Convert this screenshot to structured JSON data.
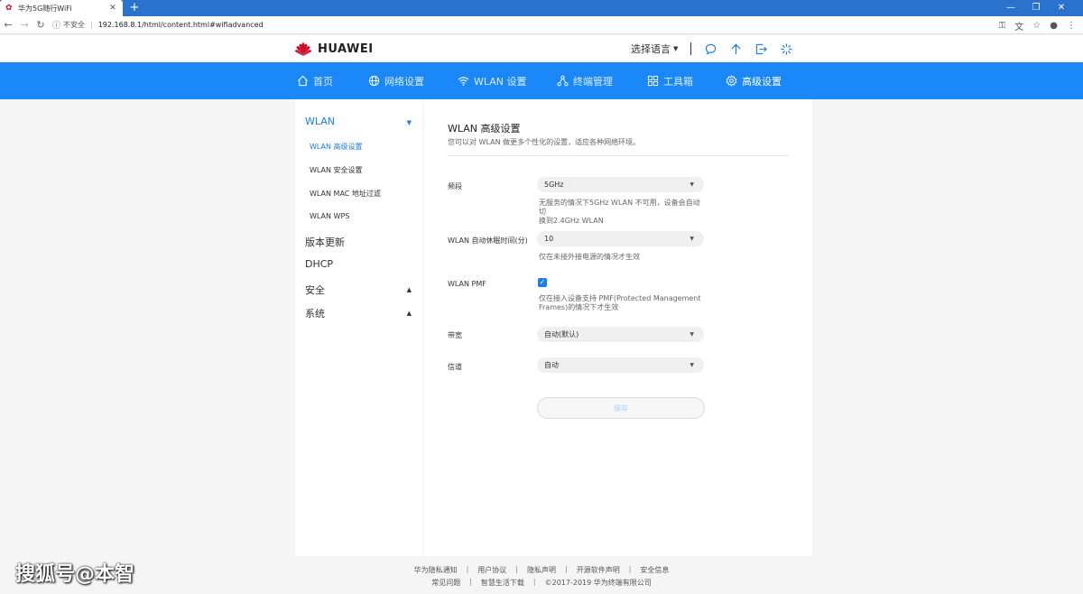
{
  "browser": {
    "tab_title": "华为5G随行WiFi",
    "new_tab": "+",
    "insecure_label": "不安全",
    "separator": "|",
    "url": "192.168.8.1/html/content.html#wifiadvanced"
  },
  "header": {
    "brand": "HUAWEI",
    "language_label": "选择语言",
    "colors": {
      "accent": "#1a7ee8",
      "nav_bg": "#1a88f8",
      "brand_red": "#cf0a2c"
    }
  },
  "nav": {
    "items": [
      {
        "label": "首页",
        "icon": "home-icon"
      },
      {
        "label": "网络设置",
        "icon": "globe-icon"
      },
      {
        "label": "WLAN 设置",
        "icon": "wifi-icon"
      },
      {
        "label": "终端管理",
        "icon": "devices-icon"
      },
      {
        "label": "工具箱",
        "icon": "toolbox-icon"
      },
      {
        "label": "高级设置",
        "icon": "gear-icon",
        "active": true
      }
    ]
  },
  "sidebar": {
    "groups": [
      {
        "label": "WLAN",
        "expanded": true,
        "active": true
      },
      {
        "label": "版本更新"
      },
      {
        "label": "DHCP"
      },
      {
        "label": "安全",
        "collapsible": true
      },
      {
        "label": "系统",
        "collapsible": true
      }
    ],
    "wlan_items": [
      {
        "label": "WLAN 高级设置",
        "active": true
      },
      {
        "label": "WLAN 安全设置"
      },
      {
        "label": "WLAN MAC 地址过滤"
      },
      {
        "label": "WLAN WPS"
      }
    ]
  },
  "main": {
    "title": "WLAN 高级设置",
    "description": "您可以对 WLAN 做更多个性化的设置，适应各种网络环境。",
    "fields": {
      "band": {
        "label": "频段",
        "value": "5GHz",
        "hint_line1": "无服务的情况下5GHz WLAN 不可用，设备会自动切",
        "hint_line2": "换到2.4GHz WLAN"
      },
      "sleep": {
        "label": "WLAN 自动休眠时间(分)",
        "value": "10",
        "hint": "仅在未接外接电源的情况才生效"
      },
      "pmf": {
        "label": "WLAN PMF",
        "checked": true,
        "hint_line1": "仅在接入设备支持 PMF(Protected Management",
        "hint_line2": "Frames)的情况下才生效"
      },
      "bandwidth": {
        "label": "带宽",
        "value": "自动(默认)"
      },
      "channel": {
        "label": "信道",
        "value": "自动"
      }
    },
    "save_label": "保存"
  },
  "footer": {
    "row1": [
      "华为隐私通知",
      "用户协议",
      "隐私声明",
      "开源软件声明",
      "安全信息"
    ],
    "row2": [
      "常见问题",
      "智慧生活下载",
      "©2017-2019 华为终端有限公司"
    ],
    "separator": "|"
  },
  "watermark": "搜狐号@本智"
}
